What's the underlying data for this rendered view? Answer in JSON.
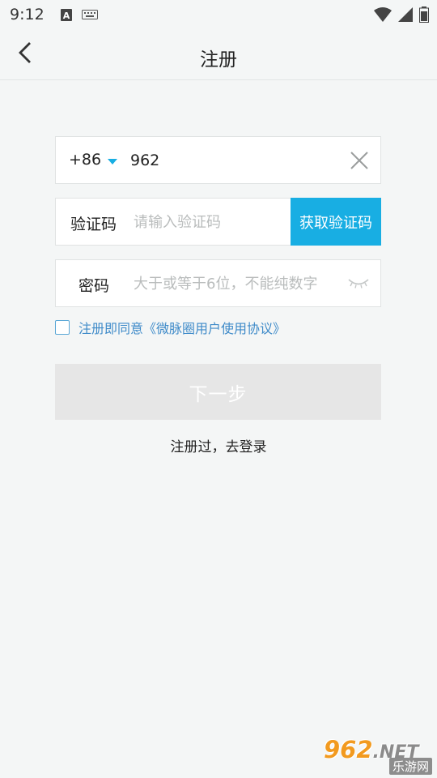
{
  "status_bar": {
    "time": "9:12",
    "icons": [
      "a-notification-icon",
      "keyboard-icon",
      "wifi-icon",
      "signal-icon",
      "battery-icon"
    ]
  },
  "header": {
    "title": "注册",
    "back_icon": "back-arrow-icon"
  },
  "phone": {
    "country_code": "+86",
    "value": "962",
    "clear_icon": "close-icon"
  },
  "verification": {
    "label": "验证码",
    "placeholder": "请输入验证码",
    "button_label": "获取验证码"
  },
  "password": {
    "label": "密码",
    "placeholder": "大于或等于6位，不能纯数字",
    "eye_icon": "eye-closed-icon"
  },
  "agreement": {
    "text": "注册即同意《微脉圈用户使用协议》",
    "checked": false
  },
  "next_button": {
    "label": "下一步"
  },
  "login_link": {
    "label": "注册过，去登录"
  },
  "watermark": {
    "top": "962",
    "net": ".NET",
    "bottom": "乐游网"
  },
  "colors": {
    "accent": "#18aee3",
    "link": "#3f8bc9",
    "background": "#f4f6f6",
    "disabled_button": "#e6e6e6"
  }
}
